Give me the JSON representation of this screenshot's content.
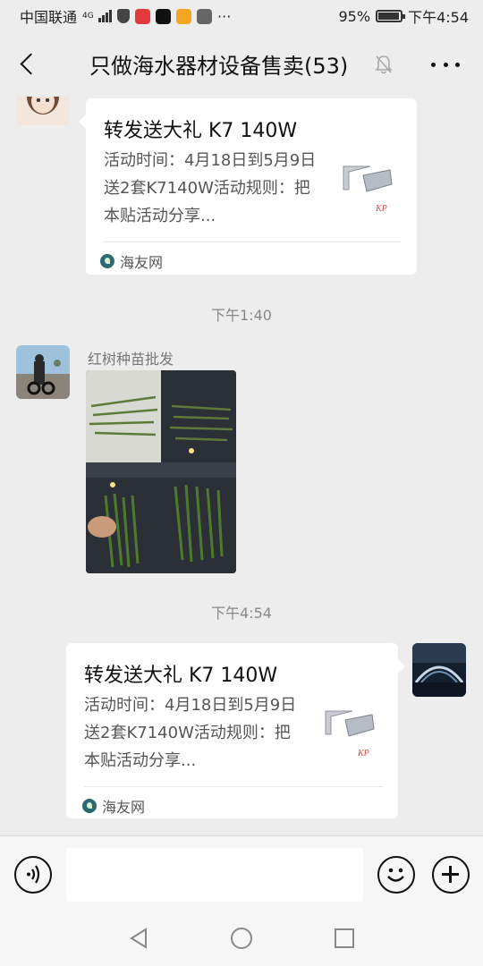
{
  "status_bar": {
    "carrier": "中国联通",
    "network": "4G",
    "battery_percent": "95%",
    "time": "下午4:54",
    "more": "···"
  },
  "header": {
    "title": "只做海水器材设备售卖(53)",
    "back_icon": "back-arrow-icon",
    "mute_icon": "bell-off-icon",
    "more_icon": "more-dots-icon"
  },
  "messages": [
    {
      "type": "link_card",
      "side": "left",
      "title": "转发送大礼 K7 140W",
      "description": "活动时间：4月18日到5月9日送2套K7140W活动规则：把本贴活动分享...",
      "source": "海友网"
    },
    {
      "type": "timestamp",
      "text": "下午1:40"
    },
    {
      "type": "image",
      "side": "left",
      "sender": "红树种苗批发"
    },
    {
      "type": "timestamp",
      "text": "下午4:54"
    },
    {
      "type": "link_card",
      "side": "right",
      "title": "转发送大礼 K7 140W",
      "description": "活动时间：4月18日到5月9日送2套K7140W活动规则：把本贴活动分享...",
      "source": "海友网"
    }
  ],
  "input_bar": {
    "voice_icon": "voice-icon",
    "input_value": "",
    "emoji_icon": "emoji-icon",
    "plus_icon": "plus-icon"
  },
  "nav_bar": {
    "back_icon": "nav-back-icon",
    "home_icon": "nav-home-icon",
    "recent_icon": "nav-recent-icon"
  },
  "colors": {
    "background": "#ededed",
    "bubble": "#ffffff",
    "text_primary": "#111111",
    "text_secondary": "#555555",
    "timestamp": "#888888",
    "source_icon": "#2b6a74"
  }
}
